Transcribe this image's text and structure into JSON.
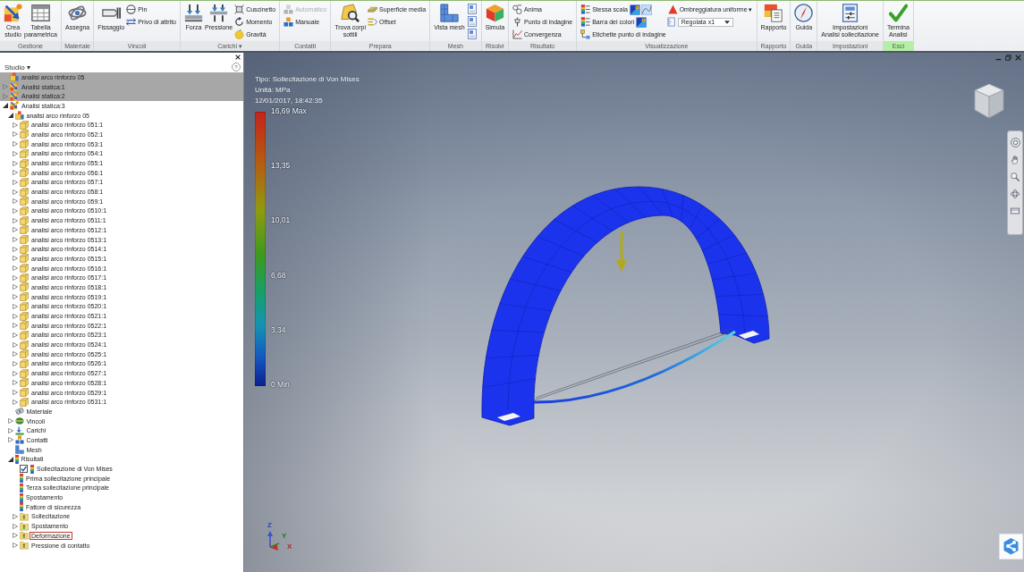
{
  "ribbon": {
    "panels": [
      {
        "label": "Gestione",
        "highlighted": false,
        "items": [
          {
            "kind": "large",
            "label": "Crea\nstudio"
          },
          {
            "kind": "large",
            "label": "Tabella\nparametrica"
          }
        ]
      },
      {
        "label": "Materiale",
        "highlighted": false,
        "items": [
          {
            "kind": "large",
            "label": "Assegna"
          }
        ]
      },
      {
        "label": "Vincoli",
        "highlighted": false,
        "items": [
          {
            "kind": "large",
            "label": "Fissaggio"
          },
          {
            "kind": "stack",
            "rows": [
              {
                "label": "Pin"
              },
              {
                "label": "Privo di attrito"
              }
            ]
          }
        ]
      },
      {
        "label": "Carichi ▾",
        "highlighted": false,
        "items": [
          {
            "kind": "large",
            "label": "Forza"
          },
          {
            "kind": "large",
            "label": "Pressione"
          },
          {
            "kind": "stack",
            "rows": [
              {
                "label": "Cuscinetto"
              },
              {
                "label": "Momento"
              },
              {
                "label": "Gravità"
              }
            ]
          }
        ]
      },
      {
        "label": "Contatti",
        "highlighted": false,
        "items": [
          {
            "kind": "stack",
            "rows": [
              {
                "label": "Automatico",
                "disabled": true
              },
              {
                "label": "Manuale",
                "disabled": false
              }
            ]
          }
        ]
      },
      {
        "label": "Prepara",
        "highlighted": false,
        "items": [
          {
            "kind": "large",
            "label": "Trova corpi\nsottili"
          },
          {
            "kind": "stack",
            "rows": [
              {
                "label": "Superficie media"
              },
              {
                "label": "Offset"
              }
            ]
          }
        ]
      },
      {
        "label": "Mesh",
        "highlighted": false,
        "items": [
          {
            "kind": "large",
            "label": "Vista mesh"
          },
          {
            "kind": "icons",
            "buttons": [
              {
                "selected": false
              },
              {
                "selected": false
              },
              {
                "selected": false
              }
            ]
          }
        ]
      },
      {
        "label": "Risolvi",
        "highlighted": false,
        "items": [
          {
            "kind": "large",
            "label": "Simula"
          }
        ]
      },
      {
        "label": "Risultato",
        "highlighted": false,
        "items": [
          {
            "kind": "stack",
            "rows": [
              {
                "label": "Anima"
              },
              {
                "label": "Punto di indagine"
              },
              {
                "label": "Convergenza"
              }
            ]
          }
        ]
      },
      {
        "label": "Visualizzazione",
        "highlighted": false,
        "items": [
          {
            "kind": "stack",
            "rows": [
              {
                "label": "Stessa scala",
                "icon_buttons": [
                  {
                    "selected": false
                  },
                  {
                    "selected": true
                  }
                ]
              },
              {
                "label": "Barra dei colori",
                "icon_buttons": [
                  {
                    "selected": false
                  }
                ]
              },
              {
                "label": "Etichette punto di indagine"
              }
            ]
          },
          {
            "kind": "stack",
            "rows": [
              {
                "kind": "button",
                "label": "Ombreggiatura uniforme ▾"
              },
              {
                "kind": "combo",
                "value": "Regolata x1"
              }
            ]
          }
        ]
      },
      {
        "label": "Rapporto",
        "highlighted": false,
        "items": [
          {
            "kind": "large",
            "label": "Rapporto"
          }
        ]
      },
      {
        "label": "Guida",
        "highlighted": false,
        "items": [
          {
            "kind": "large",
            "label": "Guida"
          }
        ]
      },
      {
        "label": "Impostazioni",
        "highlighted": false,
        "items": [
          {
            "kind": "large",
            "label": "Impostazioni\nAnalisi sollecitazione"
          }
        ]
      },
      {
        "label": "Esci",
        "highlighted": true,
        "items": [
          {
            "kind": "large",
            "label": "Termina\nAnalisi"
          }
        ]
      }
    ]
  },
  "browser": {
    "title": "Studio ▾",
    "help": "?",
    "tree": [
      {
        "kind": "assembly",
        "label": "analisi arco rinforzo 05",
        "selected": true
      },
      {
        "kind": "analysis",
        "label": "Analisi statica:1",
        "selected": true,
        "expanded": false
      },
      {
        "kind": "analysis",
        "label": "Analisi statica:2",
        "selected": true,
        "expanded": false
      },
      {
        "kind": "analysis",
        "label": "Analisi statica:3",
        "selected": false,
        "expanded": true,
        "children": [
          {
            "kind": "assembly",
            "label": "analisi arco rinforzo 05",
            "selected": false,
            "expanded": true,
            "children": [
              {
                "kind": "part",
                "label": "analisi arco rinforzo 051:1",
                "selected": false,
                "expanded": false
              },
              {
                "kind": "part",
                "label": "analisi arco rinforzo 052:1",
                "selected": false,
                "expanded": false
              },
              {
                "kind": "part",
                "label": "analisi arco rinforzo 053:1",
                "selected": false,
                "expanded": false
              },
              {
                "kind": "part",
                "label": "analisi arco rinforzo 054:1",
                "selected": false,
                "expanded": false
              },
              {
                "kind": "part",
                "label": "analisi arco rinforzo 055:1",
                "selected": false,
                "expanded": false
              },
              {
                "kind": "part",
                "label": "analisi arco rinforzo 056:1",
                "selected": false,
                "expanded": false
              },
              {
                "kind": "part",
                "label": "analisi arco rinforzo 057:1",
                "selected": false,
                "expanded": false
              },
              {
                "kind": "part",
                "label": "analisi arco rinforzo 058:1",
                "selected": false,
                "expanded": false
              },
              {
                "kind": "part",
                "label": "analisi arco rinforzo 059:1",
                "selected": false,
                "expanded": false
              },
              {
                "kind": "part",
                "label": "analisi arco rinforzo 0510:1",
                "selected": false,
                "expanded": false
              },
              {
                "kind": "part",
                "label": "analisi arco rinforzo 0511:1",
                "selected": false,
                "expanded": false
              },
              {
                "kind": "part",
                "label": "analisi arco rinforzo 0512:1",
                "selected": false,
                "expanded": false
              },
              {
                "kind": "part",
                "label": "analisi arco rinforzo 0513:1",
                "selected": false,
                "expanded": false
              },
              {
                "kind": "part",
                "label": "analisi arco rinforzo 0514:1",
                "selected": false,
                "expanded": false
              },
              {
                "kind": "part",
                "label": "analisi arco rinforzo 0515:1",
                "selected": false,
                "expanded": false
              },
              {
                "kind": "part",
                "label": "analisi arco rinforzo 0516:1",
                "selected": false,
                "expanded": false
              },
              {
                "kind": "part",
                "label": "analisi arco rinforzo 0517:1",
                "selected": false,
                "expanded": false
              },
              {
                "kind": "part",
                "label": "analisi arco rinforzo 0518:1",
                "selected": false,
                "expanded": false
              },
              {
                "kind": "part",
                "label": "analisi arco rinforzo 0519:1",
                "selected": false,
                "expanded": false
              },
              {
                "kind": "part",
                "label": "analisi arco rinforzo 0520:1",
                "selected": false,
                "expanded": false
              },
              {
                "kind": "part",
                "label": "analisi arco rinforzo 0521:1",
                "selected": false,
                "expanded": false
              },
              {
                "kind": "part",
                "label": "analisi arco rinforzo 0522:1",
                "selected": false,
                "expanded": false
              },
              {
                "kind": "part",
                "label": "analisi arco rinforzo 0523:1",
                "selected": false,
                "expanded": false
              },
              {
                "kind": "part",
                "label": "analisi arco rinforzo 0524:1",
                "selected": false,
                "expanded": false
              },
              {
                "kind": "part",
                "label": "analisi arco rinforzo 0525:1",
                "selected": false,
                "expanded": false
              },
              {
                "kind": "part",
                "label": "analisi arco rinforzo 0526:1",
                "selected": false,
                "expanded": false
              },
              {
                "kind": "part",
                "label": "analisi arco rinforzo 0527:1",
                "selected": false,
                "expanded": false
              },
              {
                "kind": "part",
                "label": "analisi arco rinforzo 0528:1",
                "selected": false,
                "expanded": false
              },
              {
                "kind": "part",
                "label": "analisi arco rinforzo 0529:1",
                "selected": false,
                "expanded": false
              },
              {
                "kind": "part",
                "label": "analisi arco rinforzo 0531:1",
                "selected": false,
                "expanded": false
              }
            ]
          },
          {
            "kind": "material",
            "label": "Materiale",
            "selected": false
          },
          {
            "kind": "constraints",
            "label": "Vincoli",
            "selected": false,
            "expanded": false
          },
          {
            "kind": "loads",
            "label": "Carichi",
            "selected": false,
            "expanded": false
          },
          {
            "kind": "contacts",
            "label": "Contatti",
            "selected": false,
            "expanded": false
          },
          {
            "kind": "mesh",
            "label": "Mesh",
            "selected": false
          },
          {
            "kind": "results",
            "label": "Risultati",
            "selected": false,
            "expanded": true,
            "children": [
              {
                "kind": "result",
                "label": "Sollecitazione di Von Mises",
                "selected": false,
                "checked": true
              },
              {
                "kind": "result",
                "label": "Prima sollecitazione principale",
                "selected": false
              },
              {
                "kind": "result",
                "label": "Terza sollecitazione principale",
                "selected": false
              },
              {
                "kind": "result",
                "label": "Spostamento",
                "selected": false
              },
              {
                "kind": "result",
                "label": "Fattore di sicurezza",
                "selected": false
              },
              {
                "kind": "folder",
                "label": "Sollecitazione",
                "selected": false,
                "expanded": false
              },
              {
                "kind": "folder",
                "label": "Spostamento",
                "selected": false,
                "expanded": false
              },
              {
                "kind": "folder",
                "label": "Deformazione",
                "selected": false,
                "expanded": false,
                "focused": true
              },
              {
                "kind": "folder",
                "label": "Pressione di contatto",
                "selected": false,
                "expanded": false
              }
            ]
          }
        ]
      }
    ]
  },
  "viewport": {
    "legend": {
      "lines": [
        "Tipo: Sollecitazione di Von Mises",
        "Unità: MPa",
        "12/01/2017, 18:42:35"
      ],
      "scale_labels": [
        "16,69 Max",
        "13,35",
        "10,01",
        "6,68",
        "3,34",
        "0 Min"
      ]
    },
    "axis_labels": [
      "Z",
      "Y",
      "X"
    ]
  }
}
